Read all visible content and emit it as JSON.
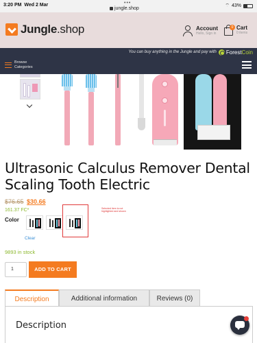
{
  "status_bar": {
    "time": "3:20 PM",
    "date": "Wed 2 Mar",
    "dots": "•••",
    "url": "jungle.shop",
    "battery": "43%",
    "battery_level": 0.43
  },
  "header": {
    "logo_brand": "Jungle",
    "logo_suffix": ".shop",
    "account_label": "Account",
    "account_sub": "Hello, Sign in",
    "cart_label": "Cart",
    "cart_sub": "0 items",
    "cart_count": "0",
    "brand_color": "#f47b20"
  },
  "navbar": {
    "promo_text": "You can buy anything in the Jungle and pay with",
    "forest": "Forest",
    "coin": "Coin",
    "browse_line1": "Browse",
    "browse_line2": "Categories"
  },
  "product": {
    "title": "Ultrasonic Calculus Remover Dental Scaling Tooth Electric",
    "old_price": "$76.65",
    "new_price": "$30.66",
    "fc_price": "161.37 FC*",
    "color_label": "Color",
    "selected_note": "Selected item is not highlighted and shown",
    "clear": "Clear",
    "stock": "9893 in stock",
    "quantity": "1",
    "add_to_cart": "ADD TO CART"
  },
  "tabs": [
    {
      "label": "Description",
      "active": true
    },
    {
      "label": "Additional information",
      "active": false
    },
    {
      "label": "Reviews (0)",
      "active": false
    }
  ],
  "panel": {
    "heading": "Description"
  }
}
